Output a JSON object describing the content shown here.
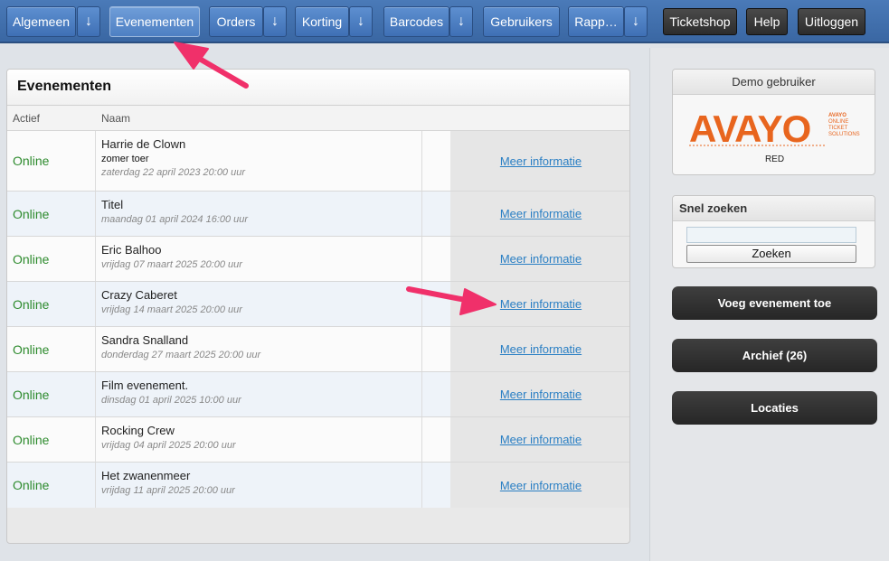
{
  "nav": {
    "items": [
      {
        "label": "Algemeen",
        "has_menu": true
      },
      {
        "label": "Evenementen",
        "has_menu": false,
        "active": true
      },
      {
        "label": "Orders",
        "has_menu": true
      },
      {
        "label": "Korting",
        "has_menu": true
      },
      {
        "label": "Barcodes",
        "has_menu": true
      },
      {
        "label": "Gebruikers",
        "has_menu": false
      },
      {
        "label": "Rapp…",
        "has_menu": true
      }
    ],
    "right": [
      {
        "label": "Ticketshop"
      },
      {
        "label": "Help"
      },
      {
        "label": "Uitloggen"
      }
    ]
  },
  "main": {
    "title": "Evenementen",
    "columns": [
      "Actief",
      "Naam"
    ],
    "link_label": "Meer informatie",
    "events": [
      {
        "status": "Online",
        "name": "Harrie de Clown",
        "subtitle": "zomer toer",
        "date": "zaterdag 22 april 2023 20:00 uur"
      },
      {
        "status": "Online",
        "name": "Titel",
        "subtitle": "",
        "date": "maandag 01 april 2024 16:00 uur"
      },
      {
        "status": "Online",
        "name": "Eric Balhoo",
        "subtitle": "",
        "date": "vrijdag 07 maart 2025 20:00 uur"
      },
      {
        "status": "Online",
        "name": "Crazy Caberet",
        "subtitle": "",
        "date": "vrijdag 14 maart 2025 20:00 uur"
      },
      {
        "status": "Online",
        "name": "Sandra Snalland",
        "subtitle": "",
        "date": "donderdag 27 maart 2025 20:00 uur"
      },
      {
        "status": "Online",
        "name": "Film evenement.",
        "subtitle": "",
        "date": "dinsdag 01 april 2025 10:00 uur"
      },
      {
        "status": "Online",
        "name": "Rocking Crew",
        "subtitle": "",
        "date": "vrijdag 04 april 2025 20:00 uur"
      },
      {
        "status": "Online",
        "name": "Het zwanenmeer",
        "subtitle": "",
        "date": "vrijdag 11 april 2025 20:00 uur"
      }
    ]
  },
  "sidebar": {
    "demo_title": "Demo gebruiker",
    "logo_text": "AVAYO",
    "logo_tag_1": "AVAYO",
    "logo_tag_2": "ONLINE",
    "logo_tag_3": "TICKET",
    "logo_tag_4": "SOLUTIONS",
    "demo_caption": "RED",
    "search_title": "Snel zoeken",
    "search_value": "",
    "search_button": "Zoeken",
    "add_event": "Voeg evenement toe",
    "archive": "Archief (26)",
    "locations": "Locaties"
  },
  "colors": {
    "nav_blue": "#3f70b5",
    "online_green": "#2e8b2e",
    "link_blue": "#2a7fc4",
    "logo_orange": "#e8651e",
    "annotation_pink": "#f0306a"
  },
  "icons": {
    "nav_dropdown": "arrow-down-icon"
  }
}
